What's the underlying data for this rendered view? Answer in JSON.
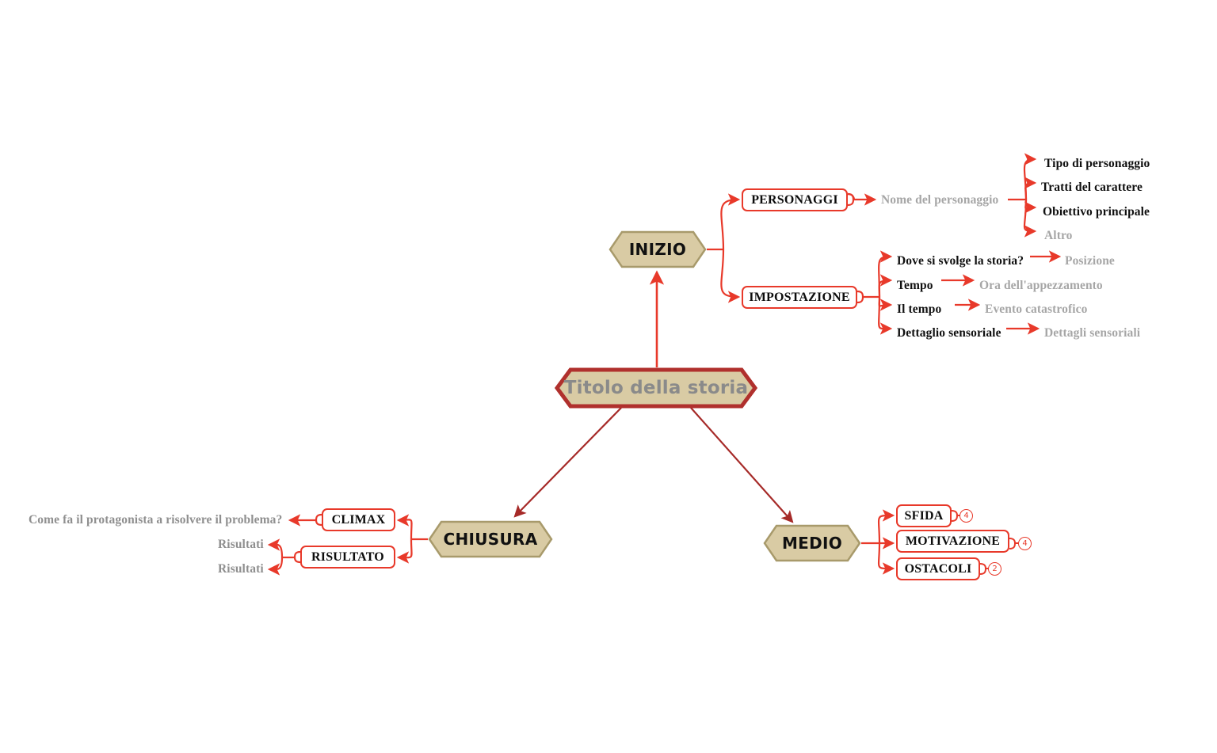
{
  "colors": {
    "node_fill": "#d9cba4",
    "node_border": "#a89a6b",
    "root_border": "#b0302d",
    "connector_bright": "#e8392a",
    "connector_dark": "#a62a28",
    "text_dark": "#101010",
    "text_gray": "#a6a6a6",
    "root_text": "#8a8a8a",
    "canvas": "#ffffff"
  },
  "root": {
    "label": "Titolo della storia"
  },
  "branches": {
    "inizio": {
      "label": "INIZIO",
      "children": [
        {
          "label": "PERSONAGGI",
          "child": {
            "label": "Nome del personaggio",
            "tone": "gray",
            "children": [
              {
                "label": "Tipo di personaggio",
                "tone": "dark"
              },
              {
                "label": "Tratti del carattere",
                "tone": "dark"
              },
              {
                "label": "Obiettivo principale",
                "tone": "dark"
              },
              {
                "label": "Altro",
                "tone": "gray"
              }
            ]
          }
        },
        {
          "label": "IMPOSTAZIONE",
          "pairs": [
            {
              "label": "Dove si svolge la storia?",
              "value": "Posizione"
            },
            {
              "label": "Tempo",
              "value": "Ora dell'appezzamento"
            },
            {
              "label": "Il tempo",
              "value": "Evento catastrofico"
            },
            {
              "label": "Dettaglio sensoriale",
              "value": "Dettagli sensoriali"
            }
          ]
        }
      ]
    },
    "medio": {
      "label": "MEDIO",
      "children": [
        {
          "label": "SFIDA",
          "count": "4"
        },
        {
          "label": "MOTIVAZIONE",
          "count": "4"
        },
        {
          "label": "OSTACOLI",
          "count": "2"
        }
      ]
    },
    "chiusura": {
      "label": "CHIUSURA",
      "children": [
        {
          "label": "CLIMAX",
          "leaves": [
            {
              "label": "Come fa il protagonista a risolvere il problema?",
              "tone": "gray"
            }
          ]
        },
        {
          "label": "RISULTATO",
          "leaves": [
            {
              "label": "Risultati",
              "tone": "gray"
            },
            {
              "label": "Risultati",
              "tone": "gray"
            }
          ]
        }
      ]
    }
  }
}
